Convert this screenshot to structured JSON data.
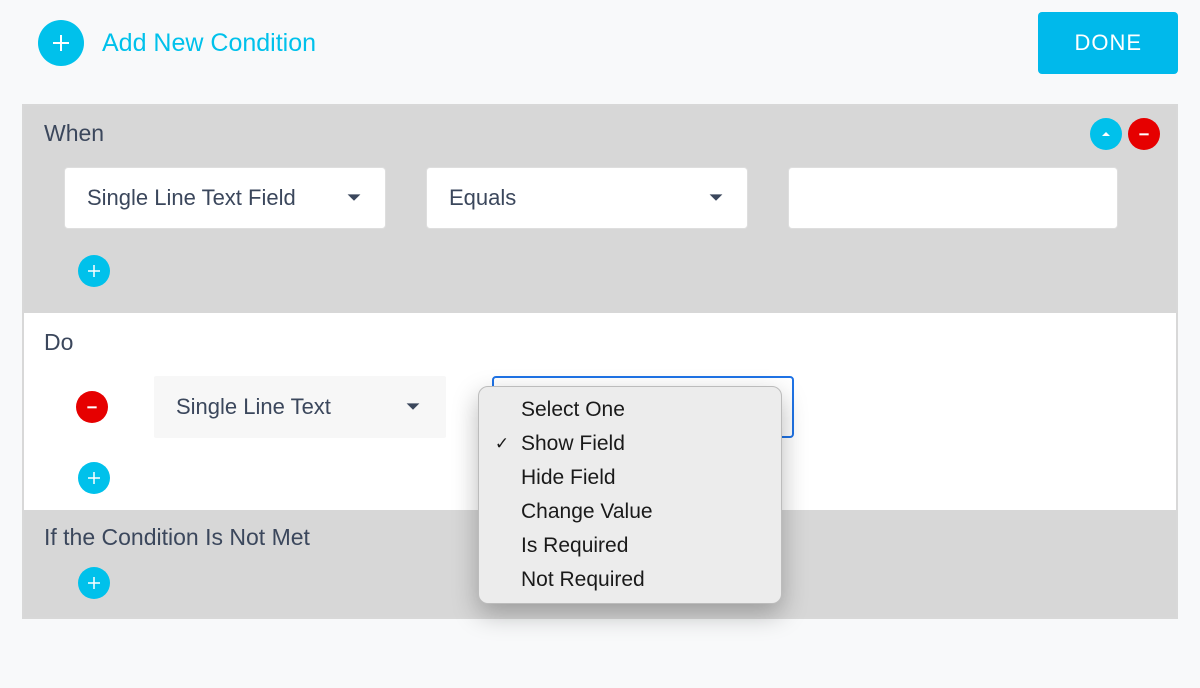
{
  "topbar": {
    "add_condition_label": "Add New Condition",
    "done_label": "DONE"
  },
  "when": {
    "title": "When",
    "field_selected": "Single Line Text Field",
    "operator_selected": "Equals",
    "value": ""
  },
  "do": {
    "title": "Do",
    "field_selected": "Single Line Text",
    "action_options": [
      {
        "label": "Select One",
        "checked": false
      },
      {
        "label": "Show Field",
        "checked": true
      },
      {
        "label": "Hide Field",
        "checked": false
      },
      {
        "label": "Change Value",
        "checked": false
      },
      {
        "label": "Is Required",
        "checked": false
      },
      {
        "label": "Not Required",
        "checked": false
      }
    ]
  },
  "else": {
    "title": "If the Condition Is Not Met"
  }
}
